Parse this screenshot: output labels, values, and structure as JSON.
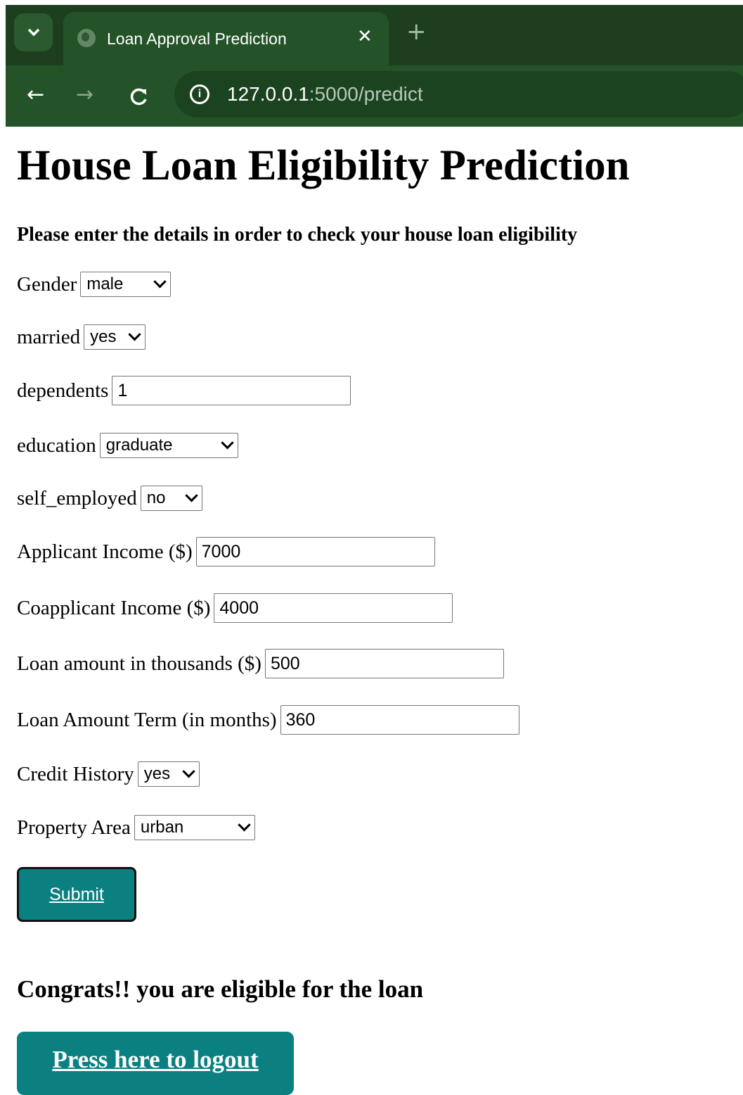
{
  "browser": {
    "tab_title": "Loan Approval Prediction",
    "url_host": "127.0.0.1",
    "url_path": ":5000/predict",
    "back_icon": "←",
    "forward_icon": "→",
    "reload_icon": "C",
    "close_icon": "✕",
    "new_tab_icon": "+",
    "tab_menu_icon": "chevron-down-icon",
    "info_icon": "ⓘ"
  },
  "page": {
    "title": "House Loan Eligibility Prediction",
    "subtitle": "Please enter the details in order to check your house loan eligibility"
  },
  "form": {
    "gender": {
      "label": "Gender",
      "value": "male"
    },
    "married": {
      "label": "married",
      "value": "yes"
    },
    "dependents": {
      "label": "dependents",
      "value": "1"
    },
    "education": {
      "label": "education",
      "value": "graduate"
    },
    "self_employed": {
      "label": "self_employed",
      "value": "no"
    },
    "applicant_income": {
      "label": "Applicant Income ($)",
      "value": "7000"
    },
    "coapplicant_income": {
      "label": "Coapplicant Income ($)",
      "value": "4000"
    },
    "loan_amount": {
      "label": "Loan amount in thousands ($)",
      "value": "500"
    },
    "loan_term": {
      "label": "Loan Amount Term (in months)",
      "value": "360"
    },
    "credit_history": {
      "label": "Credit History",
      "value": "yes"
    },
    "property_area": {
      "label": "Property Area",
      "value": "urban"
    },
    "submit_label": "Submit"
  },
  "result": {
    "message": "Congrats!! you are eligible for the loan",
    "logout_label": "Press here to logout"
  },
  "colors": {
    "chrome_dark": "#1d3f1f",
    "chrome_toolbar": "#245328",
    "button_teal": "#0a8080"
  }
}
